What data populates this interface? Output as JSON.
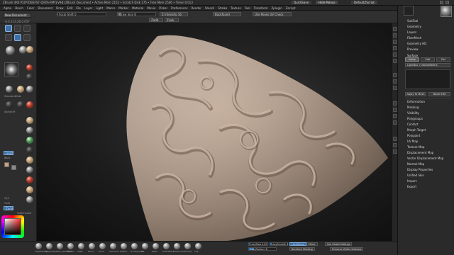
{
  "titlebar": {
    "title": "ZBrush 4R6 P2[P7DB3FS7-QVXA-RMYJ-VIHJ] ZBrush Document • Active Mem 2152 • Scratch Disk 175 • Free Mem 2546 • Timer:0.013",
    "quicksave": "QuickSave",
    "menus": "Hide Menus",
    "script": "DefaultZScript"
  },
  "menubar": {
    "items": [
      "Alpha",
      "Brush",
      "Color",
      "Document",
      "Draw",
      "Edit",
      "File",
      "Layer",
      "Light",
      "Macro",
      "Marker",
      "Material",
      "Movie",
      "Picker",
      "Preferences",
      "Render",
      "Stencil",
      "Stroke",
      "Texture",
      "Tool",
      "Transform",
      "Zplugin",
      "Zscript"
    ]
  },
  "topshelf": {
    "doc_button": "New Document",
    "focal_shift": "Focal Shift 0",
    "draw_size": "Draw Size 8",
    "zintensity": "Z Intensity 16",
    "brush_mode": "Backfaced",
    "use_poses": "Use Poses UV Check",
    "coords": "-0.4.212,26,0.057",
    "zadd": "Zadd",
    "zsub": "Zsub"
  },
  "left": {
    "labels": [
      "Edit",
      "Move",
      "Scale",
      "Rotate",
      "Standard",
      "Dots",
      "AlphaOff",
      "TextureOff",
      "Front",
      "Back",
      "Gyh",
      "Cold",
      "Zadd",
      "Base",
      "Dark",
      "Crease"
    ],
    "front": "Front",
    "back": "Back",
    "gradient": "Gyh",
    "switch": "SwitchColor",
    "colors": [
      "#c9a27c",
      "#8a8a8a"
    ]
  },
  "rightpanel": {
    "sections": [
      "SubTool",
      "Geometry",
      "Layers",
      "FiberMesh",
      "Geometry HD",
      "Preview"
    ],
    "surface_header": "Surface",
    "surface_tabs": [
      "Noise",
      "Edit",
      "Del"
    ],
    "lightbox": "LightBox > NoiseMakers",
    "buttons": [
      "Apply To Mesh",
      "Noise Edit"
    ],
    "details": [
      "Deformation",
      "Masking",
      "Visibility",
      "Polygroups",
      "Contact",
      "Morph Target",
      "Polypaint",
      "UV Map",
      "Texture Map",
      "Displacement Map",
      "Vector Displacement Map",
      "Normal Map",
      "Display Properties",
      "Unified Skin",
      "Import",
      "Export"
    ]
  },
  "bottomshelf": {
    "brushes": [
      {
        "label": "ClayBuildup"
      },
      {
        "label": "Claytubes"
      },
      {
        "label": "Dam_Standard"
      },
      {
        "label": "hPolish"
      },
      {
        "label": "Inflat"
      },
      {
        "label": "Move"
      },
      {
        "label": "Pinch"
      },
      {
        "label": "Standard"
      },
      {
        "label": "Slash3"
      },
      {
        "label": "TrimDynamic"
      },
      {
        "label": "Fill"
      },
      {
        "label": "Mask"
      },
      {
        "label": "SelectRect"
      },
      {
        "label": "SliceCurve"
      },
      {
        "label": "Smooth"
      },
      {
        "label": "Clip"
      }
    ],
    "lazy_step": "LazyStep 0.05",
    "lazy_smooth": "LazySmooth 1",
    "lazy_radius": "LazyRadius 18",
    "lazy_mouse": "LazyMouse",
    "mirror": "Mirror",
    "use_global": "Use Global Settings",
    "backface": "Backface Masking",
    "preserve": "Preserve Visible Subtools"
  },
  "colors": {
    "clay": "#b59b86",
    "clay_dark": "#6a5546",
    "accent": "#3e6fa8"
  }
}
